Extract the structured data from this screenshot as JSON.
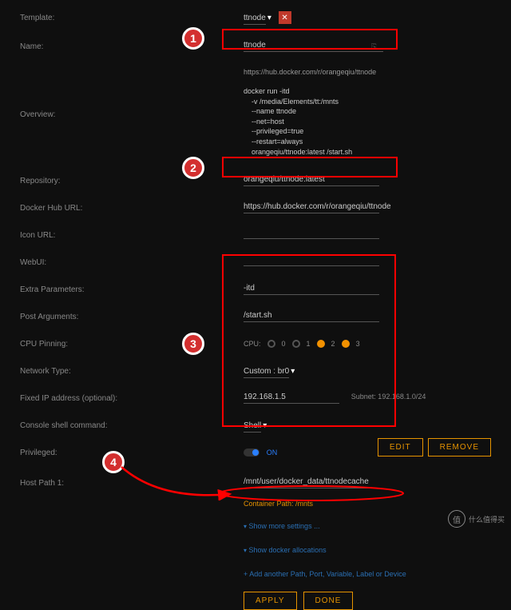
{
  "labels": {
    "template": "Template:",
    "name": "Name:",
    "overview": "Overview:",
    "repository": "Repository:",
    "docker_hub_url": "Docker Hub URL:",
    "icon_url": "Icon URL:",
    "webui": "WebUI:",
    "extra_params": "Extra Parameters:",
    "post_args": "Post Arguments:",
    "cpu_pinning": "CPU Pinning:",
    "network_type": "Network Type:",
    "fixed_ip": "Fixed IP address (optional):",
    "console_shell": "Console shell command:",
    "privileged": "Privileged:",
    "host_path_1": "Host Path 1:"
  },
  "values": {
    "template_select": "ttnode",
    "name": "ttnode",
    "hub_link_top": "https://hub.docker.com/r/orangeqiu/ttnode",
    "overview_lines": [
      "docker run -itd",
      "    -v /media/Elements/tt:/mnts",
      "    --name ttnode",
      "    --net=host",
      "    --privileged=true",
      "    --restart=always",
      "    orangeqiu/ttnode:latest /start.sh"
    ],
    "repository": "orangeqiu/ttnode:latest",
    "docker_hub_url": "https://hub.docker.com/r/orangeqiu/ttnode",
    "icon_url": "",
    "webui": "",
    "extra_params": "-itd",
    "post_args": "/start.sh",
    "cpu_label": "CPU:",
    "cpu_options": [
      "0",
      "1",
      "2",
      "3"
    ],
    "cpu_selected": [
      false,
      false,
      true,
      true
    ],
    "network_type": "Custom : br0",
    "fixed_ip": "192.168.1.5",
    "subnet": "Subnet: 192.168.1.0/24",
    "console_shell": "Shell",
    "privileged_on": "ON",
    "host_path_1": "/mnt/user/docker_data/ttnodecache",
    "container_path_label": "Container Path: /mnts"
  },
  "links": {
    "show_more": "Show more settings ...",
    "show_docker": "Show docker allocations",
    "add_another": "Add another Path, Port, Variable, Label or Device"
  },
  "buttons": {
    "edit": "EDIT",
    "remove": "REMOVE",
    "apply": "APPLY",
    "done": "DONE"
  },
  "annotations": {
    "badge1": "1",
    "badge2": "2",
    "badge3": "3",
    "badge4": "4"
  },
  "watermark": {
    "icon": "值",
    "text": "什么值得买"
  }
}
